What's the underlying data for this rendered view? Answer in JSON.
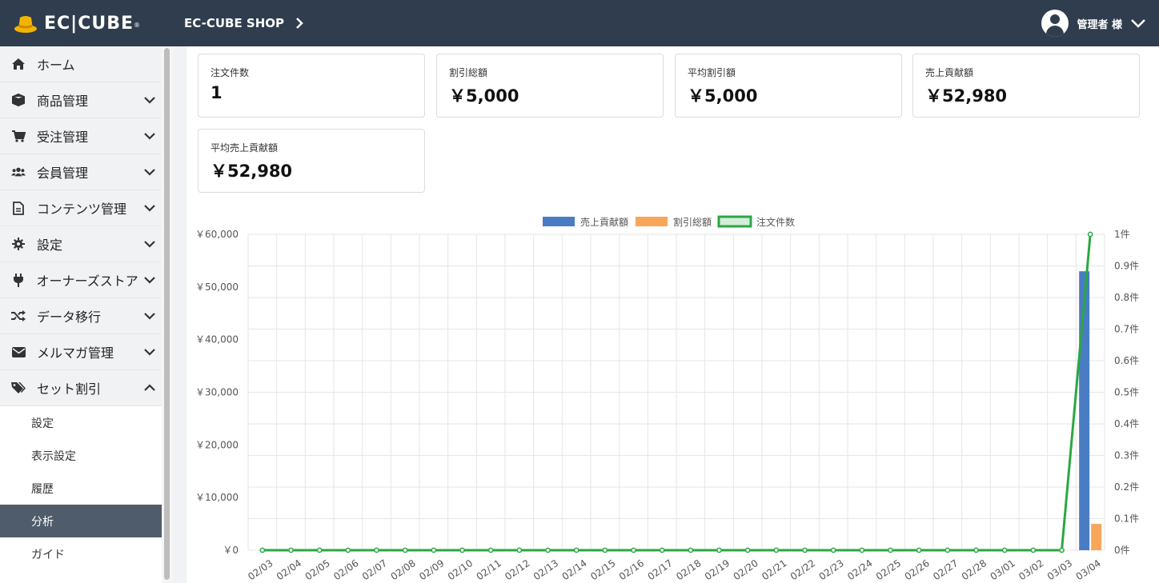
{
  "header": {
    "logo_text": "EC|CUBE",
    "logo_mark": "®",
    "shop_name": "EC-CUBE SHOP",
    "user_label": "管理者 様"
  },
  "sidebar": {
    "items": [
      {
        "label": "ホーム",
        "icon": "home-icon",
        "expanded": null
      },
      {
        "label": "商品管理",
        "icon": "box-icon",
        "expanded": false
      },
      {
        "label": "受注管理",
        "icon": "cart-icon",
        "expanded": false
      },
      {
        "label": "会員管理",
        "icon": "users-icon",
        "expanded": false
      },
      {
        "label": "コンテンツ管理",
        "icon": "document-icon",
        "expanded": false
      },
      {
        "label": "設定",
        "icon": "gear-icon",
        "expanded": false
      },
      {
        "label": "オーナーズストア",
        "icon": "plug-icon",
        "expanded": false
      },
      {
        "label": "データ移行",
        "icon": "shuffle-icon",
        "expanded": false
      },
      {
        "label": "メルマガ管理",
        "icon": "envelope-icon",
        "expanded": false
      },
      {
        "label": "セット割引",
        "icon": "tags-icon",
        "expanded": true
      }
    ],
    "sub_items": [
      {
        "label": "設定",
        "active": false
      },
      {
        "label": "表示設定",
        "active": false
      },
      {
        "label": "履歴",
        "active": false
      },
      {
        "label": "分析",
        "active": true
      },
      {
        "label": "ガイド",
        "active": false
      }
    ]
  },
  "cards": [
    {
      "label": "注文件数",
      "value": "1"
    },
    {
      "label": "割引総額",
      "value": "￥5,000"
    },
    {
      "label": "平均割引額",
      "value": "￥5,000"
    },
    {
      "label": "売上貢献額",
      "value": "￥52,980"
    },
    {
      "label": "平均売上貢献額",
      "value": "￥52,980"
    }
  ],
  "colors": {
    "header_bg": "#2f3d4e",
    "active_sub_bg": "#4f5c6b",
    "series_sales": "#4a7cc4",
    "series_discount": "#f7a65a",
    "series_orders": "#2aa842"
  },
  "chart_data": {
    "type": "bar",
    "categories": [
      "02/03",
      "02/04",
      "02/05",
      "02/06",
      "02/07",
      "02/08",
      "02/09",
      "02/10",
      "02/11",
      "02/12",
      "02/13",
      "02/14",
      "02/15",
      "02/16",
      "02/17",
      "02/18",
      "02/19",
      "02/20",
      "02/21",
      "02/22",
      "02/23",
      "02/24",
      "02/25",
      "02/26",
      "02/27",
      "02/28",
      "03/01",
      "03/02",
      "03/03",
      "03/04"
    ],
    "series": [
      {
        "name": "売上貢献額",
        "type": "bar",
        "axis": "left",
        "values": [
          0,
          0,
          0,
          0,
          0,
          0,
          0,
          0,
          0,
          0,
          0,
          0,
          0,
          0,
          0,
          0,
          0,
          0,
          0,
          0,
          0,
          0,
          0,
          0,
          0,
          0,
          0,
          0,
          0,
          52980
        ]
      },
      {
        "name": "割引総額",
        "type": "bar",
        "axis": "left",
        "values": [
          0,
          0,
          0,
          0,
          0,
          0,
          0,
          0,
          0,
          0,
          0,
          0,
          0,
          0,
          0,
          0,
          0,
          0,
          0,
          0,
          0,
          0,
          0,
          0,
          0,
          0,
          0,
          0,
          0,
          5000
        ]
      },
      {
        "name": "注文件数",
        "type": "line",
        "axis": "right",
        "values": [
          0,
          0,
          0,
          0,
          0,
          0,
          0,
          0,
          0,
          0,
          0,
          0,
          0,
          0,
          0,
          0,
          0,
          0,
          0,
          0,
          0,
          0,
          0,
          0,
          0,
          0,
          0,
          0,
          0,
          1
        ]
      }
    ],
    "y_left": {
      "ylim": [
        0,
        60000
      ],
      "ticks": [
        "￥60,000",
        "￥50,000",
        "￥40,000",
        "￥30,000",
        "￥20,000",
        "￥10,000",
        "￥0"
      ]
    },
    "y_right": {
      "ylim": [
        0,
        1
      ],
      "ticks": [
        "1件",
        "0.9件",
        "0.8件",
        "0.7件",
        "0.6件",
        "0.5件",
        "0.4件",
        "0.3件",
        "0.2件",
        "0.1件",
        "0件"
      ]
    },
    "legend_position": "top",
    "grid": true
  }
}
